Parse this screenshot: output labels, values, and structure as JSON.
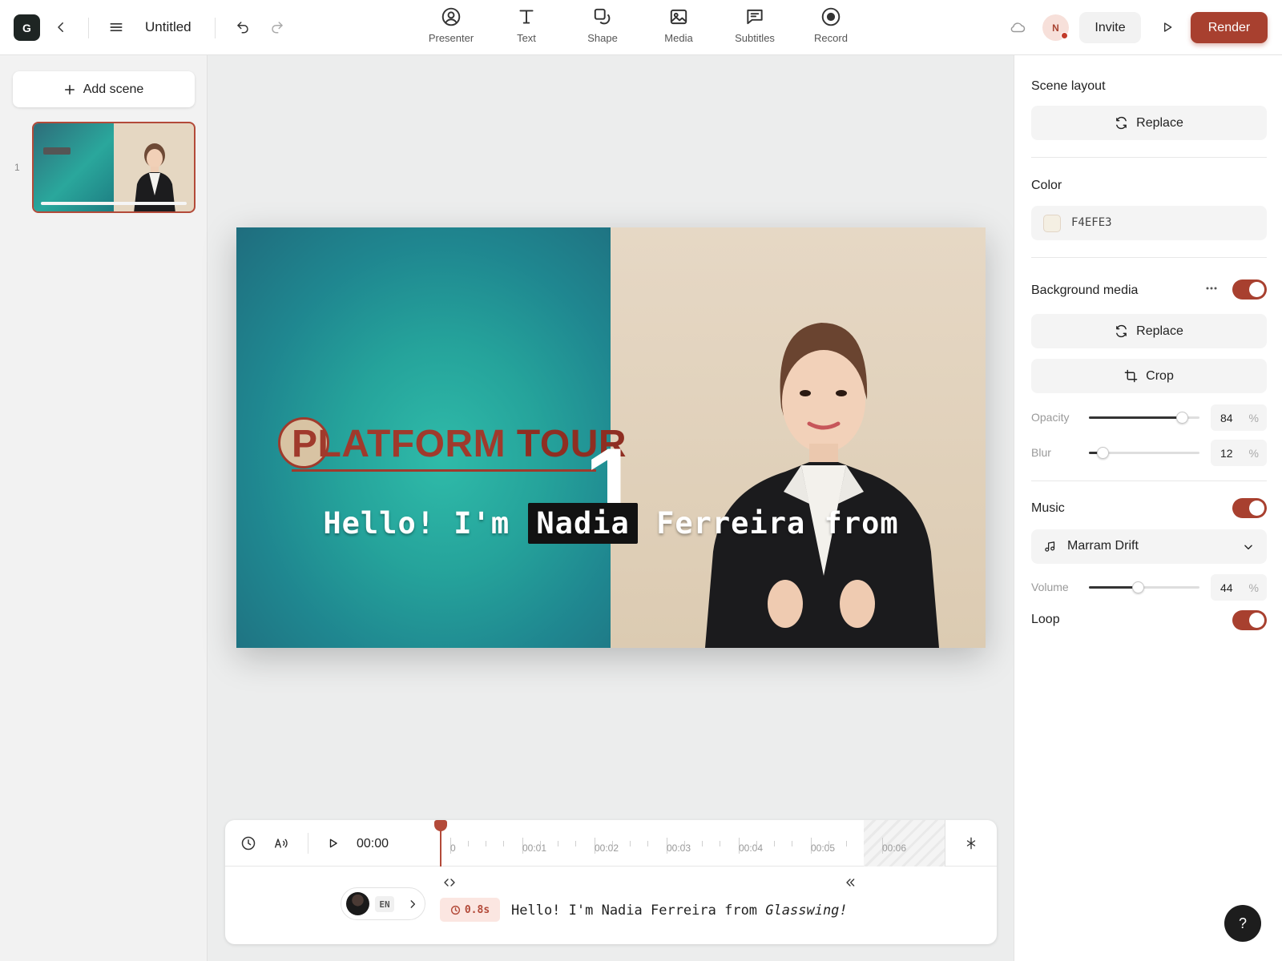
{
  "app": {
    "logo_letter": "G",
    "doc_title": "Untitled"
  },
  "toolbar": {
    "tools": [
      {
        "label": "Presenter",
        "icon": "user-circle-icon"
      },
      {
        "label": "Text",
        "icon": "text-icon"
      },
      {
        "label": "Shape",
        "icon": "shape-icon"
      },
      {
        "label": "Media",
        "icon": "image-icon"
      },
      {
        "label": "Subtitles",
        "icon": "subtitles-icon"
      },
      {
        "label": "Record",
        "icon": "record-icon"
      }
    ],
    "user_initial": "N",
    "invite_label": "Invite",
    "render_label": "Render"
  },
  "scenes": {
    "add_label": "Add scene",
    "items": [
      {
        "number": "1"
      }
    ]
  },
  "canvas": {
    "title_part1": "PLATFORM",
    "title_part2": "TOUR",
    "big_number": "1",
    "subtitle_before": "Hello! I'm",
    "subtitle_highlight": "Nadia",
    "subtitle_after": "Ferreira from"
  },
  "timeline": {
    "current_time": "00:00",
    "ticks": [
      "0",
      "00:01",
      "00:02",
      "00:03",
      "00:04",
      "00:05",
      "00:06"
    ],
    "language": "EN",
    "duration": "0.8s",
    "script_text": "Hello! I'm Nadia Ferreira from",
    "script_brand": "Glasswing!"
  },
  "properties": {
    "scene_layout": {
      "title": "Scene layout",
      "button": "Replace"
    },
    "color": {
      "title": "Color",
      "value": "F4EFE3",
      "hex": "#F4EFE3"
    },
    "background_media": {
      "title": "Background media",
      "enabled": true,
      "replace_label": "Replace",
      "crop_label": "Crop",
      "opacity_label": "Opacity",
      "opacity": "84",
      "opacity_unit": "%",
      "blur_label": "Blur",
      "blur": "12",
      "blur_unit": "%"
    },
    "music": {
      "title": "Music",
      "enabled": true,
      "track": "Marram Drift",
      "volume_label": "Volume",
      "volume": "44",
      "volume_unit": "%",
      "loop_label": "Loop",
      "loop": true
    }
  },
  "help_label": "?",
  "colors": {
    "accent": "#A8402F",
    "logo_bg": "#1E2523"
  }
}
